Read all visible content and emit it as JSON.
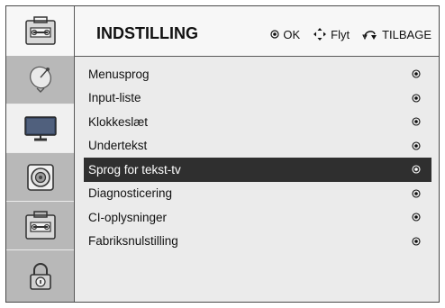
{
  "header": {
    "title": "INDSTILLING",
    "hints": [
      {
        "icon": "ok-dot-icon",
        "label": "OK"
      },
      {
        "icon": "move-arrows-icon",
        "label": "Flyt"
      },
      {
        "icon": "back-arrow-icon",
        "label": "TILBAGE"
      }
    ]
  },
  "sidebar": {
    "items": [
      {
        "icon": "satellite-dish-icon",
        "selected": false
      },
      {
        "icon": "tv-screen-icon",
        "selected": false
      },
      {
        "icon": "speaker-icon",
        "selected": false
      },
      {
        "icon": "toolbox-icon",
        "selected": true
      },
      {
        "icon": "lock-icon",
        "selected": false
      }
    ]
  },
  "menu": {
    "items": [
      {
        "label": "Menusprog"
      },
      {
        "label": "Input-liste"
      },
      {
        "label": "Klokkeslæt"
      },
      {
        "label": "Undertekst"
      },
      {
        "label": "Sprog for tekst-tv",
        "selected": true
      },
      {
        "label": "Diagnosticering"
      },
      {
        "label": "CI-oplysninger"
      },
      {
        "label": "Fabriksnulstilling"
      }
    ]
  },
  "colors": {
    "selected_bg": "#2f2f2f",
    "sidebar_shade": "#b8b8b8",
    "panel_bg": "#ebebeb"
  }
}
